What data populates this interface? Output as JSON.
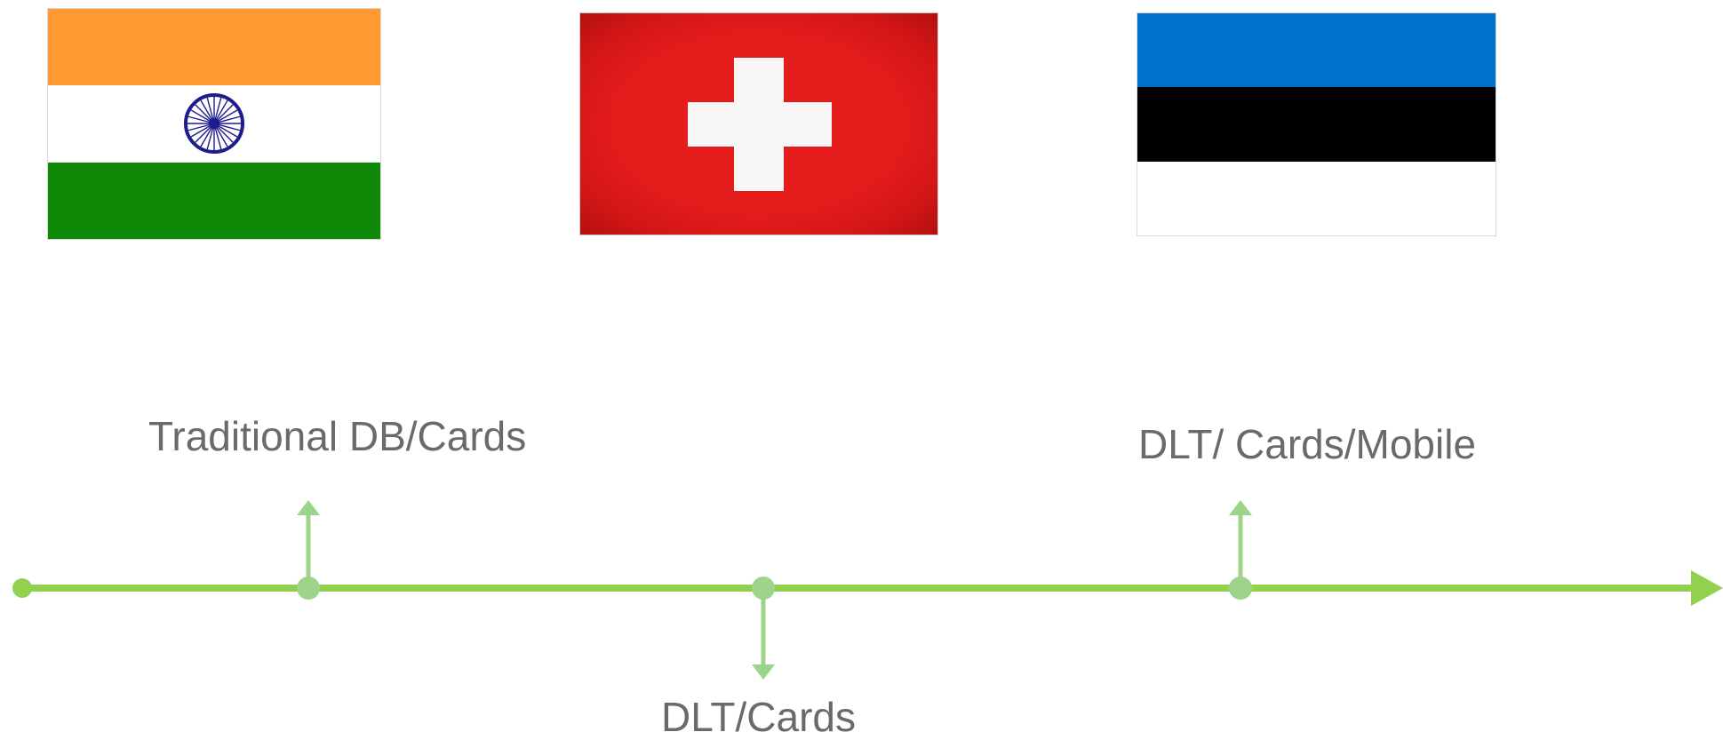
{
  "flags": [
    {
      "country": "India",
      "colors": [
        "#ff9933",
        "#ffffff",
        "#138808"
      ],
      "emblem_color": "#000080"
    },
    {
      "country": "Switzerland",
      "colors": [
        "#e01b1b",
        "#f7f7f7"
      ]
    },
    {
      "country": "Estonia",
      "colors": [
        "#0072ce",
        "#000000",
        "#ffffff"
      ]
    }
  ],
  "timeline": {
    "line_color": "#92d050",
    "marker_color": "#9ed48a",
    "milestones": [
      {
        "label": "Traditional DB/Cards",
        "direction": "up"
      },
      {
        "label": "DLT/Cards",
        "direction": "down"
      },
      {
        "label": "DLT/ Cards/Mobile",
        "direction": "up"
      }
    ]
  }
}
